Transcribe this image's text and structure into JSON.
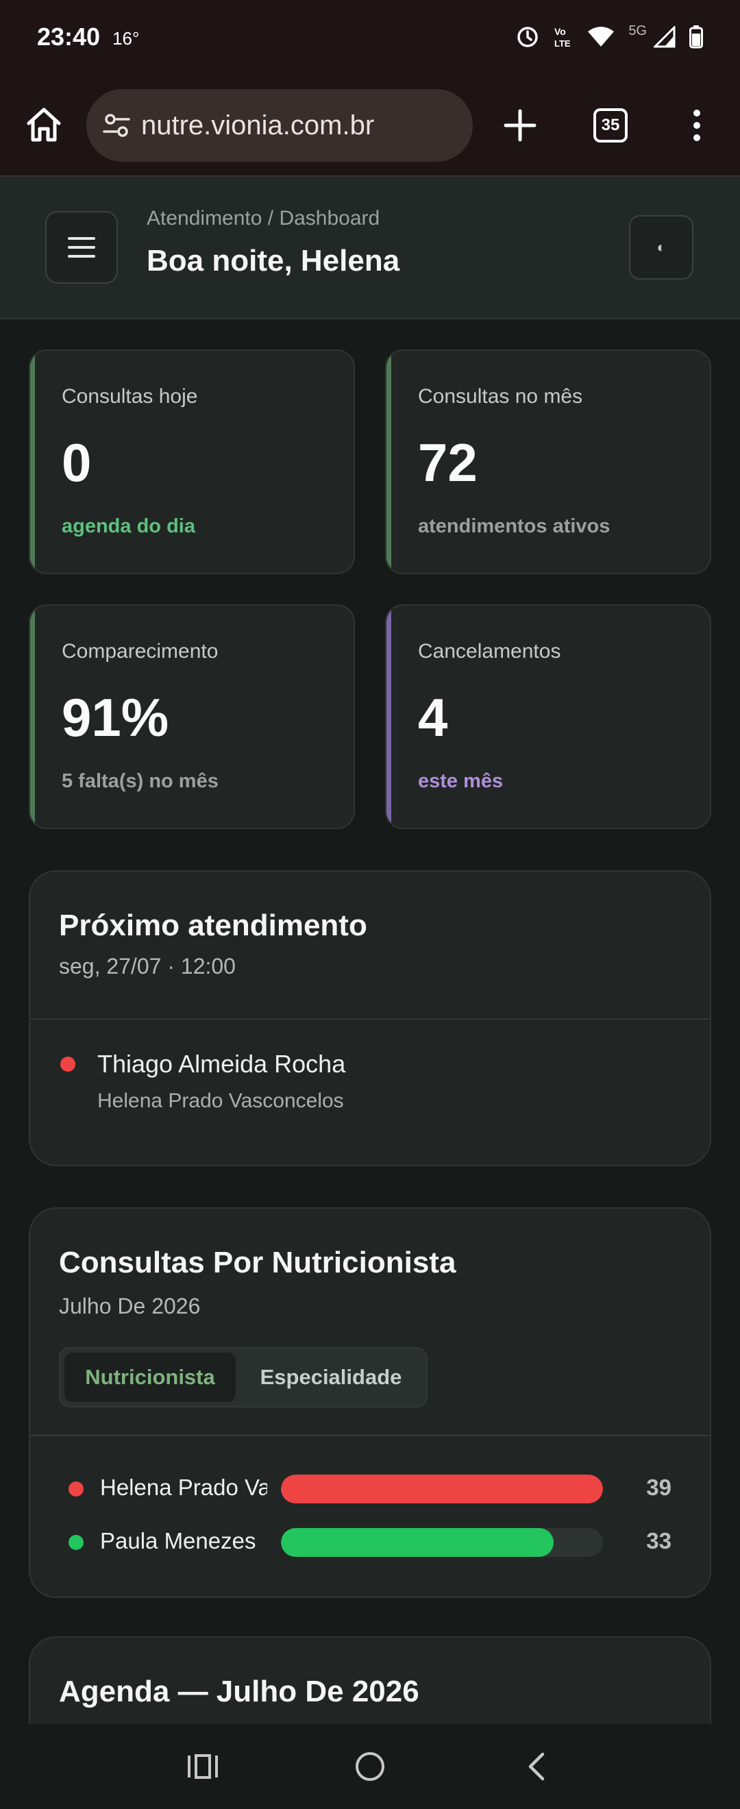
{
  "status_bar": {
    "time": "23:40",
    "temperature": "16°",
    "network": "5G",
    "volte": "Vo LTE"
  },
  "browser": {
    "url": "nutre.vionia.com.br",
    "tab_count": "35"
  },
  "header": {
    "breadcrumb": "Atendimento / Dashboard",
    "greeting": "Boa noite, Helena",
    "theme_icon": "◐"
  },
  "stats": [
    {
      "label": "Consultas hoje",
      "value": "0",
      "sub": "agenda do dia",
      "accent": "#4f7a55",
      "sub_color": "#5fbf7f"
    },
    {
      "label": "Consultas no mês",
      "value": "72",
      "sub": "atendimentos ativos",
      "accent": "#4f7a55",
      "sub_color": "#9aa19e"
    },
    {
      "label": "Comparecimento",
      "value": "91%",
      "sub": "5 falta(s) no mês",
      "accent": "#4f7a55",
      "sub_color": "#9aa19e"
    },
    {
      "label": "Cancelamentos",
      "value": "4",
      "sub": "este mês",
      "accent": "#7a66a8",
      "sub_color": "#b08fdc"
    }
  ],
  "next_appointment": {
    "title": "Próximo atendimento",
    "datetime": "seg, 27/07 · 12:00",
    "patient": "Thiago Almeida Rocha",
    "nutritionist": "Helena Prado Vasconcelos",
    "dot_color": "#ef4444"
  },
  "by_nutritionist": {
    "title": "Consultas Por Nutricionista",
    "period": "Julho De 2026",
    "tabs": [
      "Nutricionista",
      "Especialidade"
    ],
    "active_tab": "Nutricionista"
  },
  "chart_data": {
    "type": "bar",
    "orientation": "horizontal",
    "categories": [
      "Helena Prado Vasconcelos",
      "Paula Menezes"
    ],
    "values": [
      39,
      33
    ],
    "colors": [
      "#ef4444",
      "#22c55e"
    ],
    "xlim": [
      0,
      39
    ]
  },
  "agenda": {
    "title": "Agenda — Julho De 2026"
  }
}
